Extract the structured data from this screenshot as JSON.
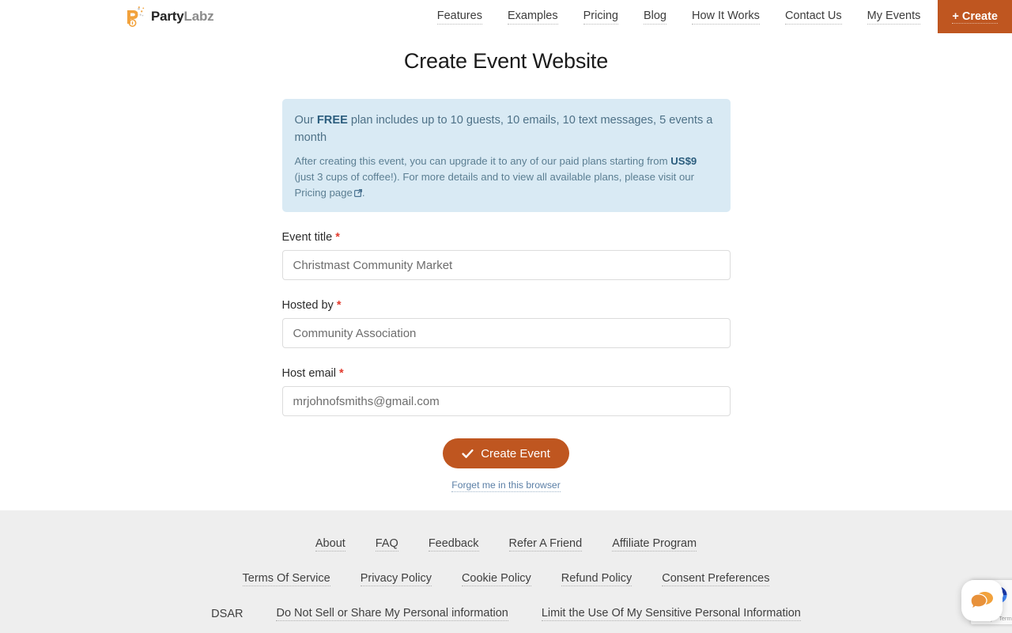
{
  "brand": {
    "name_part1": "Party",
    "name_part2": "Labz",
    "accent_color": "#bf5620",
    "logo_icon": "party-popper-p-icon"
  },
  "nav": {
    "items": [
      {
        "label": "Features"
      },
      {
        "label": "Examples"
      },
      {
        "label": "Pricing"
      },
      {
        "label": "Blog"
      },
      {
        "label": "How It Works"
      },
      {
        "label": "Contact Us"
      },
      {
        "label": "My Events"
      }
    ],
    "create_button": "+ Create"
  },
  "page": {
    "title": "Create Event Website"
  },
  "alert": {
    "line1_pre": "Our ",
    "line1_strong": "FREE",
    "line1_post": " plan includes up to 10 guests, 10 emails, 10 text messages, 5 events a month",
    "line2_pre": "After creating this event, you can upgrade it to any of our paid plans starting from ",
    "line2_strong": "US$9",
    "line2_post": " (just 3 cups of coffee!). For more details and to view all available plans, please visit our Pricing page",
    "line2_end": ".",
    "external_icon": "external-link-icon"
  },
  "form": {
    "fields": [
      {
        "label": "Event title",
        "required_marker": "*",
        "value": "Christmast Community Market",
        "placeholder": "Christmast Community Market"
      },
      {
        "label": "Hosted by",
        "required_marker": "*",
        "value": "Community Association",
        "placeholder": "Community Association"
      },
      {
        "label": "Host email",
        "required_marker": "*",
        "value": "mrjohnofsmiths@gmail.com",
        "placeholder": "mrjohnofsmiths@gmail.com"
      }
    ],
    "submit_label": "Create Event",
    "submit_icon": "check-icon",
    "forget_link": "Forget me in this browser"
  },
  "footer": {
    "row1": [
      {
        "label": "About"
      },
      {
        "label": "FAQ"
      },
      {
        "label": "Feedback"
      },
      {
        "label": "Refer A Friend"
      },
      {
        "label": "Affiliate Program"
      }
    ],
    "row2": [
      {
        "label": "Terms Of Service"
      },
      {
        "label": "Privacy Policy"
      },
      {
        "label": "Cookie Policy"
      },
      {
        "label": "Refund Policy"
      },
      {
        "label": "Consent Preferences"
      }
    ],
    "row3": [
      {
        "label": "DSAR"
      },
      {
        "label": "Do Not Sell or Share My Personal information"
      },
      {
        "label": "Limit the Use Of My Sensitive Personal Information"
      }
    ]
  },
  "widgets": {
    "recaptcha_terms": "Privacy - Terms",
    "chat_icon": "chat-bubbles-icon"
  }
}
